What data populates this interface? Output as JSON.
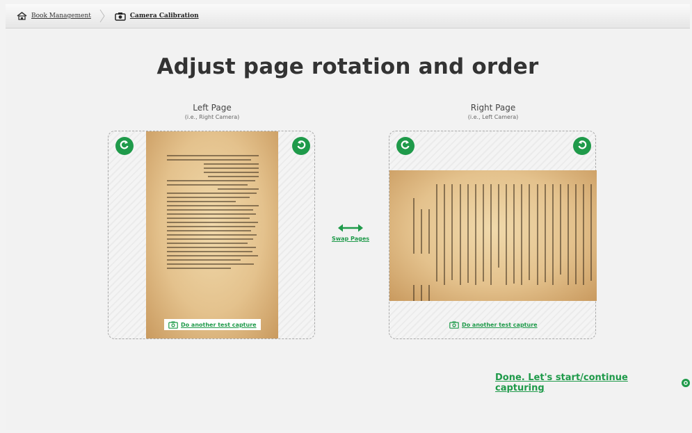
{
  "breadcrumb": {
    "home_label": "Book Management",
    "current_label": "Camera Calibration"
  },
  "title": "Adjust page rotation and order",
  "left_page": {
    "label": "Left Page",
    "sublabel": "(i.e., Right Camera)",
    "capture_label": "Do another test capture"
  },
  "right_page": {
    "label": "Right Page",
    "sublabel": "(i.e., Left Camera)",
    "capture_label": "Do another test capture"
  },
  "swap_label": "Swap Pages",
  "done_label": "Done. Let's start/continue capturing",
  "colors": {
    "accent": "#1f9a4a",
    "background": "#f2f2f2",
    "paper": "#e4c28d"
  },
  "icons": [
    "home-icon",
    "camera-icon",
    "rotate-left-icon",
    "rotate-right-icon",
    "swap-arrows-icon",
    "arrow-circle-icon"
  ]
}
